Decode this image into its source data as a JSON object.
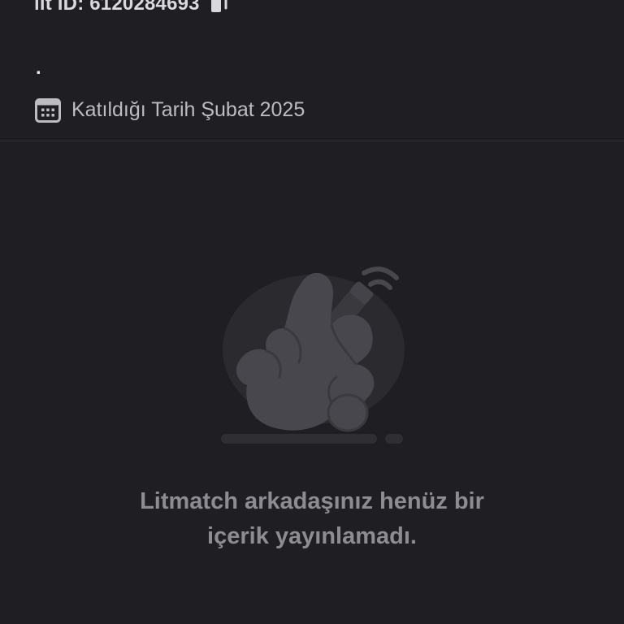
{
  "profile": {
    "lit_id_text": "lit ID: 6120284693",
    "bio": ".",
    "joined_text": "Katıldığı Tarih Şubat 2025",
    "icons": {
      "copy": "copy-icon",
      "calendar": "calendar-icon"
    }
  },
  "empty_state": {
    "illustration": "waving-hand-illustration",
    "message_line1": "Litmatch arkadaşınız henüz bir",
    "message_line2": "içerik yayınlamadı."
  },
  "colors": {
    "background": "#1f1e22",
    "primary_text": "#d9d8dc",
    "secondary_text": "#bdbcc1",
    "muted_text": "#8d8c92",
    "divider": "#313036",
    "illustration_fill": "#48474d"
  }
}
